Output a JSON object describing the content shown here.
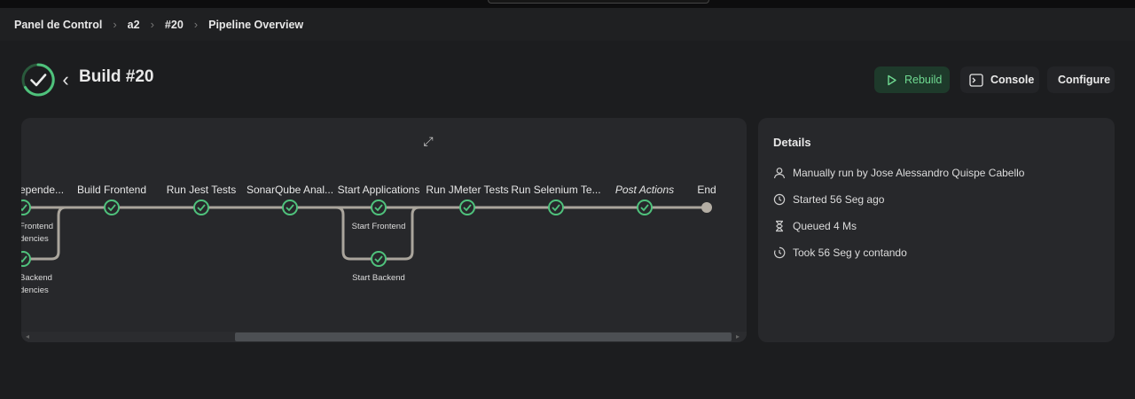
{
  "breadcrumbs": [
    "Panel de Control",
    "a2",
    "#20",
    "Pipeline Overview"
  ],
  "header": {
    "title": "Build #20",
    "status": "success",
    "rebuild_label": "Rebuild",
    "console_label": "Console",
    "configure_label": "Configure"
  },
  "colors": {
    "success": "#4fc27c",
    "rebuild_bg": "#1e3a2b",
    "rebuild_text": "#6fd991",
    "panel": "#27282b",
    "line": "#aaa59c"
  },
  "pipeline": {
    "stages": [
      "Install Dependencies",
      "Build Frontend",
      "Run Jest Tests",
      "SonarQube Analysis",
      "Start Applications",
      "Run JMeter Tests",
      "Run Selenium Tests",
      "Post Actions",
      "End"
    ],
    "stage_display": [
      "epende...",
      "Build Frontend",
      "Run Jest Tests",
      "SonarQube Anal...",
      "Start Applications",
      "Run JMeter Tests",
      "Run Selenium Te...",
      "Post Actions",
      "End"
    ],
    "parallel_install": [
      "Frontend",
      "dencies",
      "Backend",
      "dencies"
    ],
    "parallel_apps": [
      "Start Frontend",
      "Start Backend"
    ]
  },
  "details": {
    "heading": "Details",
    "rows": [
      {
        "icon": "user-icon",
        "text": "Manually run by Jose Alessandro Quispe Cabello"
      },
      {
        "icon": "clock-icon",
        "text": "Started 56 Seg ago"
      },
      {
        "icon": "hourglass-icon",
        "text": "Queued 4 Ms"
      },
      {
        "icon": "timer-icon",
        "text": "Took 56 Seg y contando"
      }
    ]
  }
}
